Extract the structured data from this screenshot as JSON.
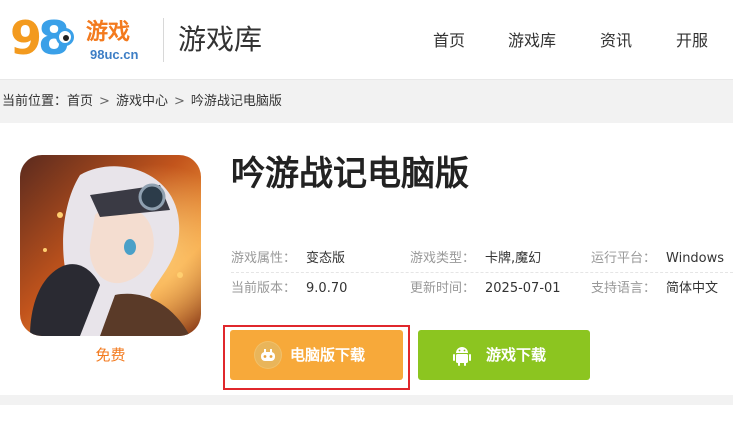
{
  "header": {
    "logo_number": "98",
    "logo_cn": "游戏",
    "logo_url": "98uc.cn",
    "section_title": "游戏库",
    "nav": [
      {
        "label": "首页"
      },
      {
        "label": "游戏库"
      },
      {
        "label": "资讯"
      },
      {
        "label": "开服"
      }
    ]
  },
  "breadcrumb": {
    "prefix": "当前位置：",
    "items": [
      "首页",
      "游戏中心",
      "吟游战记电脑版"
    ],
    "separator": ">"
  },
  "game": {
    "title": "吟游战记电脑版",
    "price_label": "免费",
    "info": {
      "attribute_key": "游戏属性：",
      "attribute_value": "变态版",
      "type_key": "游戏类型：",
      "type_value": "卡牌,魔幻",
      "platform_key": "运行平台：",
      "platform_value": "Windows",
      "version_key": "当前版本：",
      "version_value": "9.0.70",
      "updated_key": "更新时间：",
      "updated_value": "2025-07-01",
      "language_key": "支持语言：",
      "language_value": "简体中文"
    },
    "buttons": {
      "pc_download": "电脑版下载",
      "game_download": "游戏下载"
    }
  },
  "colors": {
    "brand_orange": "#f37a1e",
    "pc_button": "#f7a93a",
    "game_button": "#8cc520",
    "highlight_border": "#e0272c"
  }
}
